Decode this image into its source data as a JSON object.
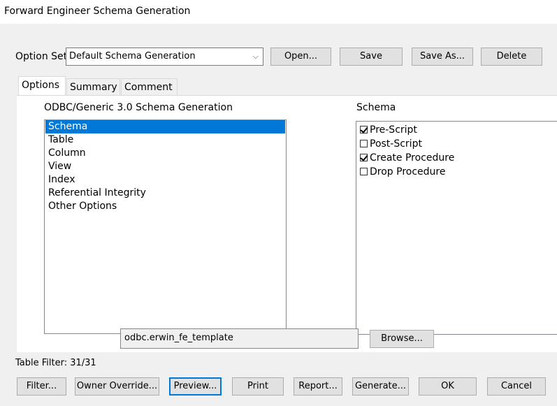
{
  "window": {
    "title": "Forward Engineer Schema Generation"
  },
  "option_set": {
    "label": "Option Set:",
    "value": "Default Schema Generation",
    "buttons": {
      "open": "Open...",
      "save": "Save",
      "save_as": "Save As...",
      "delete": "Delete"
    }
  },
  "tabs": [
    {
      "label": "Options"
    },
    {
      "label": "Summary"
    },
    {
      "label": "Comment"
    }
  ],
  "left": {
    "heading": "ODBC/Generic 3.0 Schema Generation",
    "items": [
      "Schema",
      "Table",
      "Column",
      "View",
      "Index",
      "Referential Integrity",
      "Other Options"
    ],
    "selected": "Schema"
  },
  "right": {
    "heading": "Schema",
    "checkboxes": [
      {
        "label": "Pre-Script",
        "checked": true
      },
      {
        "label": "Post-Script",
        "checked": false
      },
      {
        "label": "Create Procedure",
        "checked": true
      },
      {
        "label": "Drop Procedure",
        "checked": false
      }
    ]
  },
  "template": {
    "value": "odbc.erwin_fe_template",
    "browse": "Browse..."
  },
  "table_filter": "Table Filter: 31/31",
  "bottom_buttons": {
    "filter": "Filter...",
    "owner_override": "Owner Override...",
    "preview": "Preview...",
    "print": "Print",
    "report": "Report...",
    "generate": "Generate...",
    "ok": "OK",
    "cancel": "Cancel"
  },
  "colors": {
    "accent": "#0078d7",
    "button_bg": "#e1e1e1",
    "window_bg": "#f0f0f0"
  }
}
